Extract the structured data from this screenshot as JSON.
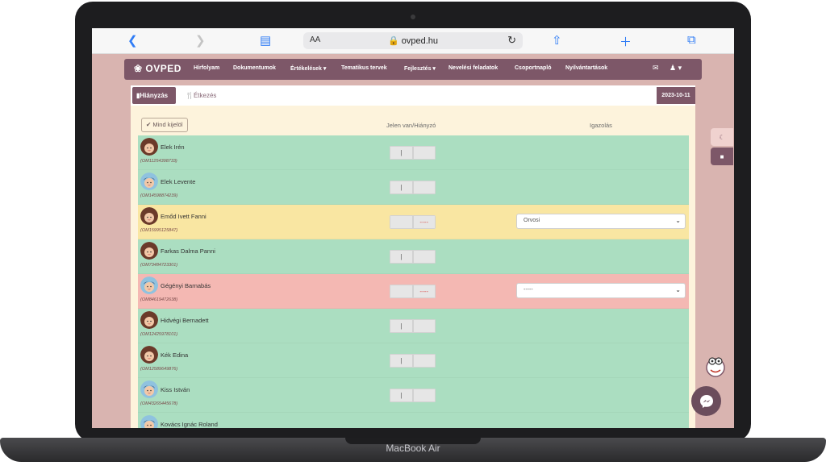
{
  "device": {
    "label": "MacBook Air"
  },
  "browser": {
    "aa_label": "AA",
    "url": "ovped.hu"
  },
  "nav": {
    "logo": "OVPED",
    "items": [
      "Hírfolyam",
      "Dokumentumok",
      "Értékelések",
      "Tematikus tervek",
      "Fejlesztés",
      "Nevelési feladatok",
      "Csoportnapló",
      "Nyilvántartások"
    ]
  },
  "tabs": {
    "absence": "Hiányzás",
    "meals": "Étkezés"
  },
  "date": "2023-10-11",
  "table": {
    "select_all": "Mind kijelöl",
    "col_presence": "Jelen van/Hiányzó",
    "col_excuse": "Igazolás"
  },
  "students": [
    {
      "name": "Elek Irén",
      "om": "(OM11254398733)",
      "status": "present",
      "gender": "female"
    },
    {
      "name": "Elek Levente",
      "om": "(OM14598874239)",
      "status": "present",
      "gender": "male"
    },
    {
      "name": "Emőd Ivett Fanni",
      "om": "(OM15995125847)",
      "status": "excused",
      "gender": "female",
      "reason": "Orvosi"
    },
    {
      "name": "Farkas Dalma Panni",
      "om": "(OM73484723301)",
      "status": "present",
      "gender": "female"
    },
    {
      "name": "Gégényi Barnabás",
      "om": "(OM84619472638)",
      "status": "absent",
      "gender": "male",
      "reason": "-----"
    },
    {
      "name": "Hidvégi Bernadett",
      "om": "(OM12425978101)",
      "status": "present",
      "gender": "female"
    },
    {
      "name": "Kék Edina",
      "om": "(OM12589649876)",
      "status": "present",
      "gender": "female"
    },
    {
      "name": "Kiss István",
      "om": "(OM43265445678)",
      "status": "present",
      "gender": "male"
    },
    {
      "name": "Kovács Ignác Roland",
      "om": "",
      "status": "present",
      "gender": "male"
    }
  ],
  "colors": {
    "brand": "#7d5768",
    "present": "#abdec1",
    "excused": "#f9e6a2",
    "absent": "#f4b8b3"
  }
}
